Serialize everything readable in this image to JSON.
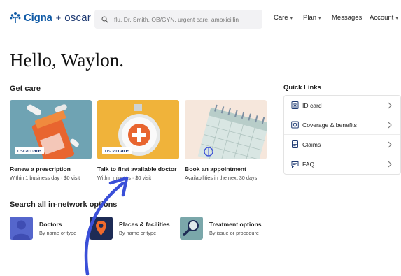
{
  "header": {
    "logo_cigna": "Cigna",
    "logo_plus": "+",
    "logo_oscar": "oscar",
    "search_placeholder": "flu, Dr. Smith, OB/GYN, urgent care, amoxicillin",
    "nav": [
      {
        "label": "Care",
        "has_dropdown": true
      },
      {
        "label": "Plan",
        "has_dropdown": true
      },
      {
        "label": "Messages",
        "has_dropdown": false
      },
      {
        "label": "Account",
        "has_dropdown": true
      }
    ]
  },
  "greeting": "Hello, Waylon.",
  "get_care": {
    "title": "Get care",
    "cards": [
      {
        "title": "Renew a prescription",
        "subtitle": "Within 1 business day · $0 visit",
        "badge_prefix": "oscar",
        "badge_suffix": "care",
        "color": "#6fa3b3"
      },
      {
        "title": "Talk to first available doctor",
        "subtitle": "Within minutes · $0 visit",
        "badge_prefix": "oscar",
        "badge_suffix": "care",
        "color": "#f0b33a"
      },
      {
        "title": "Book an appointment",
        "subtitle": "Availabilities in the next 30 days",
        "color": "#f6e7dc"
      }
    ]
  },
  "search_options": {
    "title": "Search all in-network options",
    "items": [
      {
        "title": "Doctors",
        "subtitle": "By name or type",
        "color": "#5566cc"
      },
      {
        "title": "Places & facilities",
        "subtitle": "By name or type",
        "color": "#1d2b55"
      },
      {
        "title": "Treatment options",
        "subtitle": "By issue or procedure",
        "color": "#7aa7aa"
      }
    ]
  },
  "quick_links": {
    "title": "Quick Links",
    "items": [
      {
        "label": "ID card",
        "icon": "id-card-icon"
      },
      {
        "label": "Coverage & benefits",
        "icon": "shield-icon"
      },
      {
        "label": "Claims",
        "icon": "document-icon"
      },
      {
        "label": "FAQ",
        "icon": "chat-bubble-icon"
      }
    ]
  },
  "colors": {
    "accent_blue": "#3a4fd8",
    "brand_blue": "#0f5aa6",
    "oscar_navy": "#1f3b73"
  }
}
